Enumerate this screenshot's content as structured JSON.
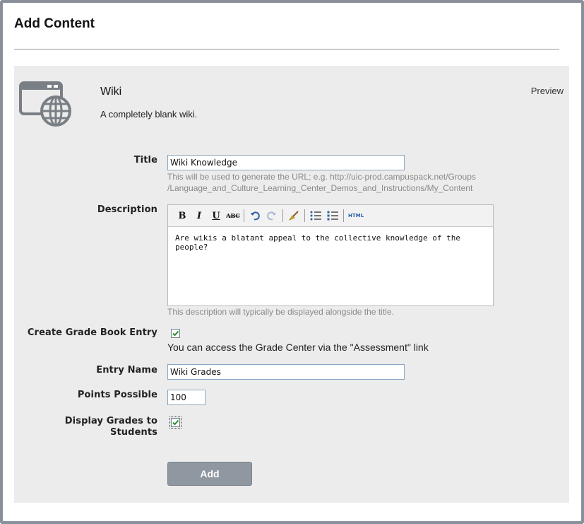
{
  "page": {
    "title": "Add Content"
  },
  "app": {
    "icon": "web-window-globe-icon",
    "name": "Wiki",
    "description": "A completely blank wiki.",
    "preview_label": "Preview"
  },
  "form": {
    "title": {
      "label": "Title",
      "value": "Wiki Knowledge",
      "hint_line1": "This will be used to generate the URL; e.g. http://uic-prod.campuspack.net/Groups",
      "hint_line2": "/Language_and_Culture_Learning_Center_Demos_and_Instructions/My_Content"
    },
    "description": {
      "label": "Description",
      "toolbar": [
        "bold",
        "italic",
        "underline",
        "strikethrough",
        "undo",
        "redo",
        "clean",
        "bullet-list",
        "numbered-list",
        "html"
      ],
      "toolbar_labels": {
        "bold": "B",
        "italic": "I",
        "underline": "U",
        "strike": "ABC",
        "html": "HTML"
      },
      "value": "Are wikis a blatant appeal to the collective knowledge of the people?",
      "hint": "This description will typically be displayed alongside the title."
    },
    "grade_book": {
      "label": "Create Grade Book Entry",
      "checked": true,
      "note": "You can access the Grade Center via the \"Assessment\" link"
    },
    "entry_name": {
      "label": "Entry Name",
      "value": "Wiki Grades"
    },
    "points_possible": {
      "label": "Points Possible",
      "value": "100"
    },
    "display_grades": {
      "label_line1": "Display Grades to",
      "label_line2": "Students",
      "checked": true
    },
    "submit_label": "Add"
  },
  "colors": {
    "panel": "#ececec",
    "button": "#8f97a1",
    "frame": "#8a9099",
    "check": "#2e8b2e"
  }
}
